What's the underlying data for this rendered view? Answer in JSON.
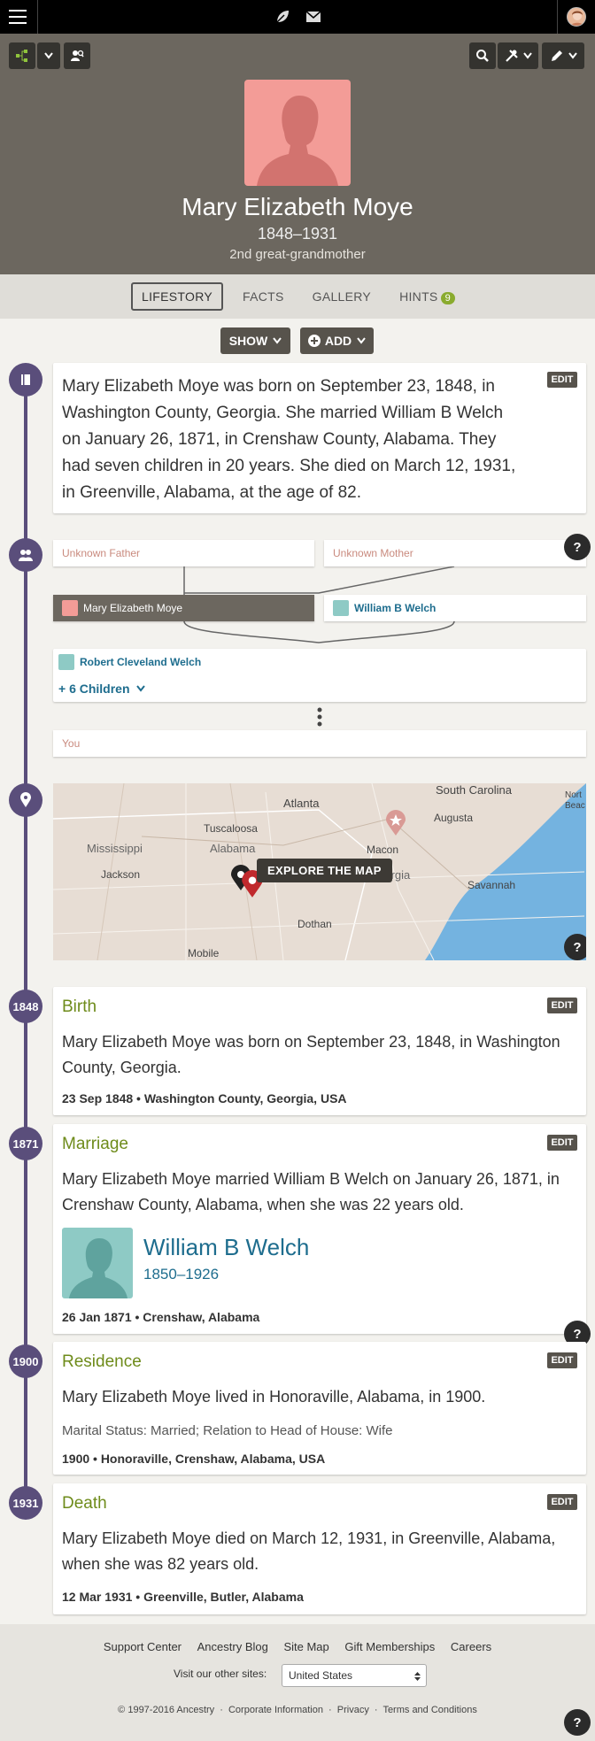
{
  "person": {
    "name": "Mary Elizabeth Moye",
    "dates": "1848–1931",
    "relation": "2nd great-grandmother"
  },
  "tabs": [
    {
      "label": "LIFESTORY"
    },
    {
      "label": "FACTS"
    },
    {
      "label": "GALLERY"
    },
    {
      "label": "HINTS",
      "badge": "9"
    }
  ],
  "controls": {
    "show": "SHOW",
    "add": "ADD"
  },
  "story": "Mary Elizabeth Moye was born on September 23, 1848, in Washington County, Georgia. She married William B Welch on January 26, 1871, in Crenshaw County, Alabama. They had seven children in 20 years. She died on March 12, 1931, in Greenville, Alabama, at the age of 82.",
  "edit_label": "EDIT",
  "family": {
    "father": "Unknown Father",
    "mother": "Unknown Mother",
    "self": "Mary Elizabeth Moye",
    "spouse": "William B Welch",
    "child": "Robert Cleveland Welch",
    "more_children": "+ 6 Children",
    "you": "You"
  },
  "map": {
    "cta": "EXPLORE THE MAP",
    "labels": [
      "Atlanta",
      "South Carolina",
      "Tuscaloosa",
      "Augusta",
      "Mississippi",
      "Alabama",
      "Macon",
      "Jackson",
      "Georgia",
      "Savannah",
      "Dothan",
      "Mobile",
      "Nort",
      "Beac"
    ]
  },
  "events": [
    {
      "year": "1848",
      "title": "Birth",
      "text": "Mary Elizabeth Moye was born on September 23, 1848, in Washington County, Georgia.",
      "meta": "23 Sep 1848 • Washington County, Georgia, USA"
    },
    {
      "year": "1871",
      "title": "Marriage",
      "text": "Mary Elizabeth Moye married William B Welch on January 26, 1871, in Crenshaw County, Alabama, when she was 22 years old.",
      "spouse_name": "William B Welch",
      "spouse_dates": "1850–1926",
      "meta": "26 Jan 1871 • Crenshaw, Alabama"
    },
    {
      "year": "1900",
      "title": "Residence",
      "text": "Mary Elizabeth Moye lived in Honoraville, Alabama, in 1900.",
      "sub": "Marital Status: Married; Relation to Head of House: Wife",
      "meta": "1900 • Honoraville, Crenshaw, Alabama, USA"
    },
    {
      "year": "1931",
      "title": "Death",
      "text": "Mary Elizabeth Moye died on March 12, 1931, in Greenville, Alabama, when she was 82 years old.",
      "meta": "12 Mar 1931 • Greenville, Butler, Alabama"
    }
  ],
  "help": "?",
  "footer": {
    "links": [
      "Support Center",
      "Ancestry Blog",
      "Site Map",
      "Gift Memberships",
      "Careers"
    ],
    "visit_label": "Visit our other sites:",
    "site_select": "United States",
    "copyright": "© 1997-2016 Ancestry",
    "legal": [
      "Corporate Information",
      "Privacy",
      "Terms and Conditions"
    ]
  },
  "colors": {
    "timeline": "#5a4e7b",
    "event_title": "#6e8b1a",
    "header_bg": "#6c675f",
    "link": "#1e6d8e"
  }
}
